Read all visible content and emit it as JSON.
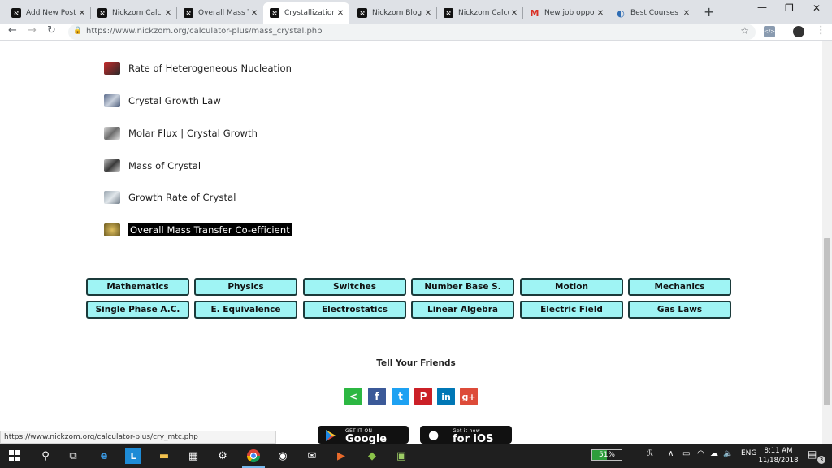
{
  "browser": {
    "tabs": [
      {
        "title": "Add New Post",
        "active": false
      },
      {
        "title": "Nickzom Calcu",
        "active": false
      },
      {
        "title": "Overall Mass T",
        "active": false
      },
      {
        "title": "Crystallization",
        "active": true
      },
      {
        "title": "Nickzom Blog",
        "active": false
      },
      {
        "title": "Nickzom Calcu",
        "active": false
      },
      {
        "title": "New job oppo",
        "active": false
      },
      {
        "title": "Best Courses",
        "active": false
      }
    ],
    "new_tab": "+",
    "url": "https://www.nickzom.org/calculator-plus/mass_crystal.php"
  },
  "links": [
    {
      "label": "Rate of Heterogeneous Nucleation"
    },
    {
      "label": "Crystal Growth Law"
    },
    {
      "label": "Molar Flux | Crystal Growth"
    },
    {
      "label": "Mass of Crystal"
    },
    {
      "label": "Growth Rate of Crystal"
    },
    {
      "label": "Overall Mass Transfer Co-efficient"
    }
  ],
  "categories": {
    "row1": [
      "Mathematics",
      "Physics",
      "Switches",
      "Number Base S.",
      "Motion",
      "Mechanics"
    ],
    "row2": [
      "Single Phase A.C.",
      "E. Equivalence",
      "Electrostatics",
      "Linear Algebra",
      "Electric Field",
      "Gas Laws"
    ]
  },
  "share": {
    "heading": "Tell Your Friends",
    "buttons": [
      {
        "glyph": "<",
        "color": "#2cb742"
      },
      {
        "glyph": "f",
        "color": "#3b5998"
      },
      {
        "glyph": "t",
        "color": "#1da1f2"
      },
      {
        "glyph": "P",
        "color": "#cb2027"
      },
      {
        "glyph": "in",
        "color": "#0077b5"
      },
      {
        "glyph": "g+",
        "color": "#dd4b39"
      }
    ]
  },
  "stores": {
    "google_small": "GET IT ON",
    "google_big": "Google Play",
    "ios_small": "Get it now",
    "ios_big": "for iOS"
  },
  "status_url": "https://www.nickzom.org/calculator-plus/cry_mtc.php",
  "taskbar": {
    "battery": "51%",
    "battery_level": 0.51,
    "language": "ENG",
    "time": "8:11 AM",
    "date": "11/18/2018",
    "notifications": "3"
  }
}
